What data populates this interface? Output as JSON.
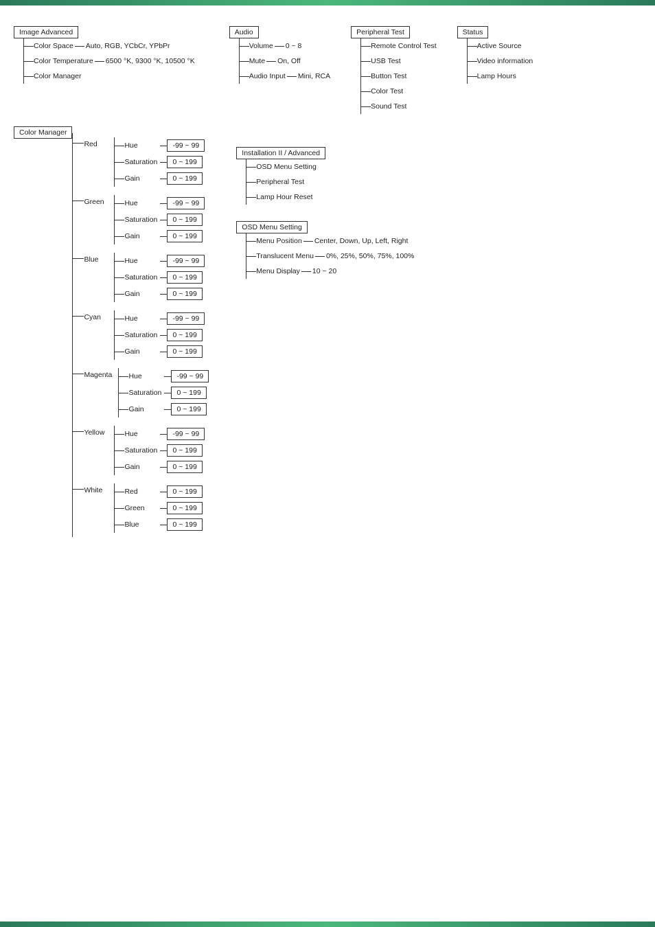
{
  "topBar": {},
  "sections": {
    "imageAdvanced": {
      "title": "Image Advanced",
      "children": [
        {
          "label": "Color Space",
          "value": "Auto, RGB, YCbCr, YPbPr"
        },
        {
          "label": "Color Temperature",
          "value": "6500 °K, 9300 °K, 10500 °K"
        },
        {
          "label": "Color Manager",
          "value": ""
        }
      ]
    },
    "audio": {
      "title": "Audio",
      "children": [
        {
          "label": "Volume",
          "value": "0 ~ 8"
        },
        {
          "label": "Mute",
          "value": "On, Off"
        },
        {
          "label": "Audio Input",
          "value": "Mini, RCA"
        }
      ]
    },
    "peripheralTest": {
      "title": "Peripheral Test",
      "children": [
        {
          "label": "Remote Control Test",
          "value": ""
        },
        {
          "label": "USB Test",
          "value": ""
        },
        {
          "label": "Button Test",
          "value": ""
        },
        {
          "label": "Color Test",
          "value": ""
        },
        {
          "label": "Sound Test",
          "value": ""
        }
      ]
    },
    "status": {
      "title": "Status",
      "children": [
        {
          "label": "Active Source",
          "value": ""
        },
        {
          "label": "Video information",
          "value": ""
        },
        {
          "label": "Lamp Hours",
          "value": ""
        }
      ]
    },
    "colorManager": {
      "title": "Color Manager",
      "groups": [
        {
          "label": "Red",
          "props": [
            {
              "name": "Hue",
              "value": "-99 ~ 99"
            },
            {
              "name": "Saturation",
              "value": "0 ~ 199"
            },
            {
              "name": "Gain",
              "value": "0 ~ 199"
            }
          ]
        },
        {
          "label": "Green",
          "props": [
            {
              "name": "Hue",
              "value": "-99 ~ 99"
            },
            {
              "name": "Saturation",
              "value": "0 ~ 199"
            },
            {
              "name": "Gain",
              "value": "0 ~ 199"
            }
          ]
        },
        {
          "label": "Blue",
          "props": [
            {
              "name": "Hue",
              "value": "-99 ~ 99"
            },
            {
              "name": "Saturation",
              "value": "0 ~ 199"
            },
            {
              "name": "Gain",
              "value": "0 ~ 199"
            }
          ]
        },
        {
          "label": "Cyan",
          "props": [
            {
              "name": "Hue",
              "value": "-99 ~ 99"
            },
            {
              "name": "Saturation",
              "value": "0 ~ 199"
            },
            {
              "name": "Gain",
              "value": "0 ~ 199"
            }
          ]
        },
        {
          "label": "Magenta",
          "props": [
            {
              "name": "Hue",
              "value": "-99 ~ 99"
            },
            {
              "name": "Saturation",
              "value": "0 ~ 199"
            },
            {
              "name": "Gain",
              "value": "0 ~ 199"
            }
          ]
        },
        {
          "label": "Yellow",
          "props": [
            {
              "name": "Hue",
              "value": "-99 ~ 99"
            },
            {
              "name": "Saturation",
              "value": "0 ~ 199"
            },
            {
              "name": "Gain",
              "value": "0 ~ 199"
            }
          ]
        },
        {
          "label": "White",
          "props": [
            {
              "name": "Red",
              "value": "0 ~ 199"
            },
            {
              "name": "Green",
              "value": "0 ~ 199"
            },
            {
              "name": "Blue",
              "value": "0 ~ 199"
            }
          ]
        }
      ]
    },
    "installationAdvanced": {
      "title": "Installation II / Advanced",
      "children": [
        {
          "label": "OSD Menu Setting",
          "value": ""
        },
        {
          "label": "Peripheral Test",
          "value": ""
        },
        {
          "label": "Lamp Hour Reset",
          "value": ""
        }
      ]
    },
    "osdMenuSetting": {
      "title": "OSD Menu Setting",
      "children": [
        {
          "label": "Menu Position",
          "value": "Center, Down, Up, Left, Right"
        },
        {
          "label": "Translucent Menu",
          "value": "0%, 25%, 50%, 75%, 100%"
        },
        {
          "label": "Menu Display",
          "value": "10 ~ 20"
        }
      ]
    }
  }
}
